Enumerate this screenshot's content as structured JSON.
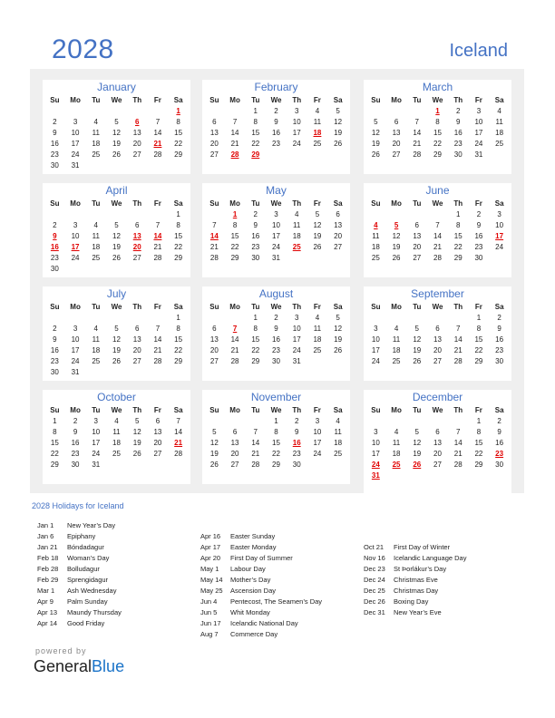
{
  "header": {
    "year": "2028",
    "country": "Iceland"
  },
  "weekdays": [
    "Su",
    "Mo",
    "Tu",
    "We",
    "Th",
    "Fr",
    "Sa"
  ],
  "months": [
    {
      "name": "January",
      "start": 6,
      "days": 31,
      "holidays": [
        1,
        6,
        21
      ]
    },
    {
      "name": "February",
      "start": 2,
      "days": 29,
      "holidays": [
        18,
        28,
        29
      ]
    },
    {
      "name": "March",
      "start": 3,
      "days": 31,
      "holidays": [
        1
      ]
    },
    {
      "name": "April",
      "start": 6,
      "days": 30,
      "holidays": [
        9,
        13,
        14,
        16,
        17,
        20
      ]
    },
    {
      "name": "May",
      "start": 1,
      "days": 31,
      "holidays": [
        1,
        14,
        25
      ]
    },
    {
      "name": "June",
      "start": 4,
      "days": 30,
      "holidays": [
        4,
        5,
        17
      ]
    },
    {
      "name": "July",
      "start": 6,
      "days": 31,
      "holidays": []
    },
    {
      "name": "August",
      "start": 2,
      "days": 31,
      "holidays": [
        7
      ]
    },
    {
      "name": "September",
      "start": 5,
      "days": 30,
      "holidays": []
    },
    {
      "name": "October",
      "start": 0,
      "days": 31,
      "holidays": [
        21
      ]
    },
    {
      "name": "November",
      "start": 3,
      "days": 30,
      "holidays": [
        16
      ]
    },
    {
      "name": "December",
      "start": 5,
      "days": 31,
      "holidays": [
        23,
        24,
        25,
        26,
        31
      ]
    }
  ],
  "holidays_heading": "2028 Holidays for Iceland",
  "holiday_columns": [
    [
      {
        "date": "Jan 1",
        "name": "New Year’s Day"
      },
      {
        "date": "Jan 6",
        "name": "Epiphany"
      },
      {
        "date": "Jan 21",
        "name": "Bóndadagur"
      },
      {
        "date": "Feb 18",
        "name": "Woman’s Day"
      },
      {
        "date": "Feb 28",
        "name": "Bolludagur"
      },
      {
        "date": "Feb 29",
        "name": "Sprengidagur"
      },
      {
        "date": "Mar 1",
        "name": "Ash Wednesday"
      },
      {
        "date": "Apr 9",
        "name": "Palm Sunday"
      },
      {
        "date": "Apr 13",
        "name": "Maundy Thursday"
      },
      {
        "date": "Apr 14",
        "name": "Good Friday"
      }
    ],
    [
      {
        "date": "Apr 16",
        "name": "Easter Sunday"
      },
      {
        "date": "Apr 17",
        "name": "Easter Monday"
      },
      {
        "date": "Apr 20",
        "name": "First Day of Summer"
      },
      {
        "date": "May 1",
        "name": "Labour Day"
      },
      {
        "date": "May 14",
        "name": "Mother’s Day"
      },
      {
        "date": "May 25",
        "name": "Ascension Day"
      },
      {
        "date": "Jun 4",
        "name": "Pentecost, The Seamen’s Day"
      },
      {
        "date": "Jun 5",
        "name": "Whit Monday"
      },
      {
        "date": "Jun 17",
        "name": "Icelandic National Day"
      },
      {
        "date": "Aug 7",
        "name": "Commerce Day"
      }
    ],
    [
      {
        "date": "Oct 21",
        "name": "First Day of Winter"
      },
      {
        "date": "Nov 16",
        "name": "Icelandic Language Day"
      },
      {
        "date": "Dec 23",
        "name": "St Þorlákur’s Day"
      },
      {
        "date": "Dec 24",
        "name": "Christmas Eve"
      },
      {
        "date": "Dec 25",
        "name": "Christmas Day"
      },
      {
        "date": "Dec 26",
        "name": "Boxing Day"
      },
      {
        "date": "Dec 31",
        "name": "New Year’s Eve"
      }
    ]
  ],
  "footer": {
    "powered_by": "powered by",
    "brand_part1": "General",
    "brand_part2": "Blue"
  },
  "colors": {
    "accent": "#4472C4",
    "holiday": "#e00000",
    "panel": "#efefef"
  }
}
